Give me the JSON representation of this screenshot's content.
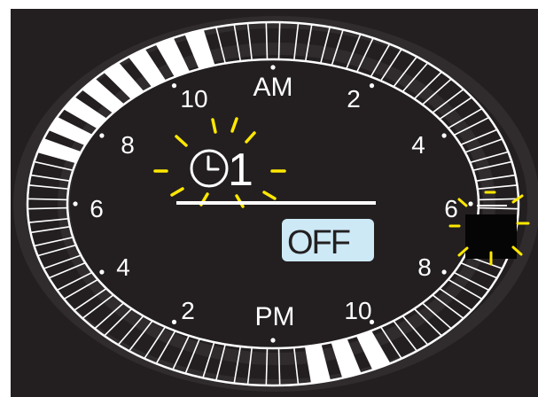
{
  "display": {
    "am_label": "AM",
    "pm_label": "PM",
    "upper_hours": [
      "8",
      "10",
      "2",
      "4"
    ],
    "lower_hours": [
      "4",
      "2",
      "10",
      "8"
    ],
    "side_hours": [
      "6",
      "6"
    ],
    "timer_number": "1",
    "timer_state_label": "OFF",
    "icons": [
      "clock-icon",
      "blink-rays-icon"
    ],
    "colors": {
      "background": "#231f20",
      "segment_line": "#ffffff",
      "blink_rays": "#ffe800",
      "off_badge": "#cde9f6"
    }
  }
}
